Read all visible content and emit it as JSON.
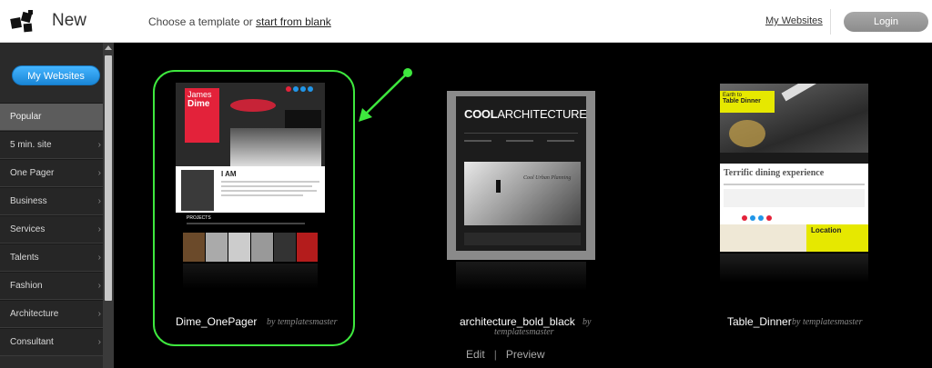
{
  "header": {
    "title": "New",
    "hint_prefix": "Choose a template or ",
    "hint_link": "start from blank",
    "my_websites": "My Websites",
    "login": "Login"
  },
  "sidebar": {
    "my_websites_button": "My Websites",
    "categories": [
      {
        "label": "Popular"
      },
      {
        "label": "5 min. site"
      },
      {
        "label": "One Pager"
      },
      {
        "label": "Business"
      },
      {
        "label": "Services"
      },
      {
        "label": "Talents"
      },
      {
        "label": "Fashion"
      },
      {
        "label": "Architecture"
      },
      {
        "label": "Consultant"
      }
    ]
  },
  "templates": [
    {
      "name": "Dime_OnePager",
      "by": "by templatesmaster",
      "thumb": {
        "name_line1": "James",
        "name_line2": "Dime",
        "heading": "I AM",
        "section": "PROJECTS"
      }
    },
    {
      "name": "architecture_bold_black",
      "by": "by",
      "by2": "templatesmaster",
      "edit": "Edit",
      "separator": "|",
      "preview": "Preview",
      "thumb": {
        "title_bold": "COOL",
        "title_rest": "ARCHITECTURE",
        "subtitle": "Cool Urban Planning"
      }
    },
    {
      "name": "Table_Dinner",
      "by": "by templatesmaster",
      "thumb": {
        "label_line1": "Earth to",
        "label_line2": "Table Dinner",
        "headline": "Terrific dining experience",
        "location": "Location"
      }
    }
  ],
  "colors": {
    "accent_blue": "#2196e8",
    "highlight_green": "#3ee83e",
    "dime_red": "#e3223a",
    "dinner_yellow": "#e6e800"
  }
}
